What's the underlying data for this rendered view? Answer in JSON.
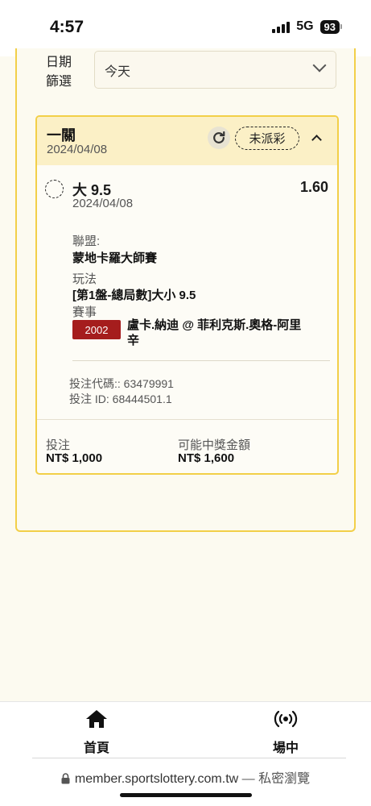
{
  "status": {
    "time": "4:57",
    "network": "5G",
    "battery": "93"
  },
  "filter": {
    "label": "日期\n篩選",
    "label_line1": "日期",
    "label_line2": "篩選",
    "value": "今天"
  },
  "bet": {
    "title": "一關",
    "date": "2024/04/08",
    "status_badge": "未派彩",
    "selection": {
      "title": "大 9.5",
      "date": "2024/04/08",
      "odds": "1.60"
    },
    "league_label": "聯盟:",
    "league_value": "蒙地卡羅大師賽",
    "play_label": "玩法",
    "play_value": "[第1盤-總局數]大小 9.5",
    "event_label": "賽事",
    "match_id": "2002",
    "match_name": "盧卡.納迪 @ 菲利克斯.奧格-阿里辛",
    "bet_code": "投注代碼:: 63479991",
    "bet_id": "投注 ID: 68444501.1",
    "stake_label": "投注",
    "stake_value": "NT$ 1,000",
    "payout_label": "可能中獎金額",
    "payout_value": "NT$ 1,600"
  },
  "nav": {
    "home_label": "首頁",
    "live_label": "場中",
    "home_icon": "home-icon",
    "live_icon": "broadcast-icon"
  },
  "browser": {
    "url": "member.sportslottery.com.tw",
    "suffix": " — 私密瀏覽"
  }
}
